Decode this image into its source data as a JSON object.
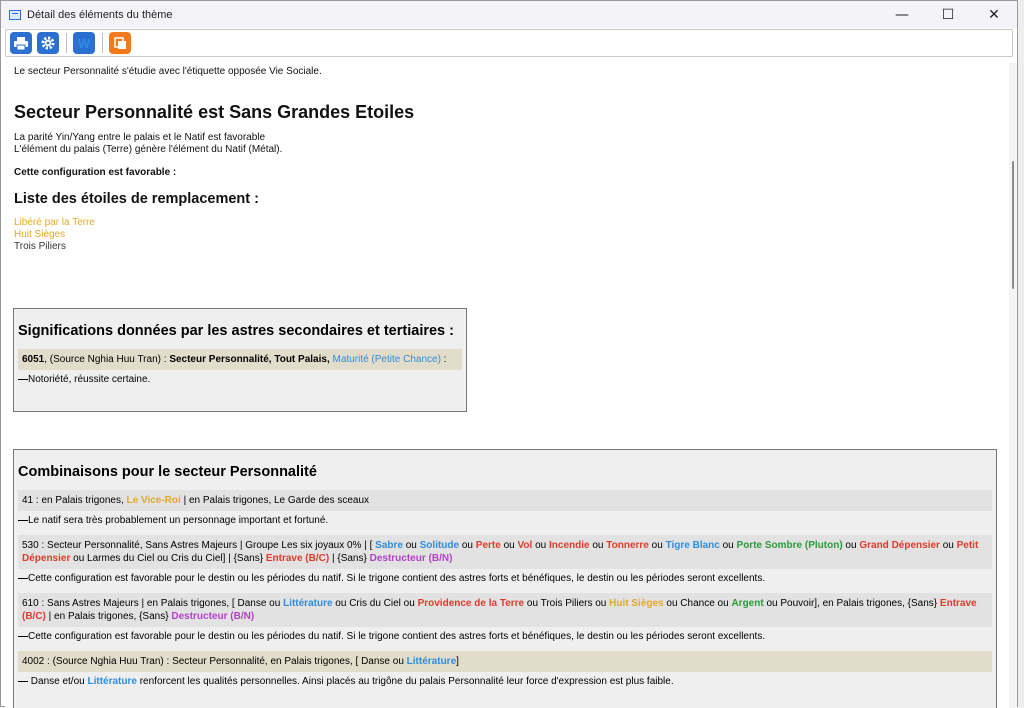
{
  "window": {
    "title": "Détail des éléments du thème",
    "minimize": "—",
    "maximize": "☐",
    "close": "✕"
  },
  "toolbar": {
    "print_icon": "print-icon",
    "settings_icon": "gear-icon",
    "word_label": "W",
    "export_icon": "copy-icon"
  },
  "intro": {
    "line": "Le secteur Personnalité s'étudie avec l'étiquette opposée Vie Sociale."
  },
  "section1": {
    "title": "Secteur Personnalité est Sans Grandes Etoiles",
    "line1": "La parité Yin/Yang entre le palais et le Natif est favorable",
    "line2": "L'élément du palais (Terre) génère l'élément du Natif (Métal).",
    "config": "Cette configuration est favorable :"
  },
  "replacement": {
    "title": "Liste des étoiles de remplacement :",
    "stars": [
      "Libéré par la Terre",
      "Huit Sièges",
      "Trois Piliers"
    ]
  },
  "significations": {
    "title": "Significations données par les astres secondaires et tertiaires :",
    "entry": {
      "id": "6051",
      "source": ", (Source Nghia Huu Tran) : ",
      "sector": "Secteur Personnalité, Tout Palais, ",
      "star": "Maturité (Petite Chance)",
      "colon": " :",
      "desc": "Notoriété, réussite certaine."
    }
  },
  "combinaisons": {
    "title": "Combinaisons pour le secteur Personnalité",
    "c41": {
      "pre": "41 : en Palais trigones, ",
      "star": "Le Vice-Roi",
      "post": " | en Palais trigones, Le Garde des sceaux",
      "desc": "Le natif sera très probablement un personnage important et fortuné."
    },
    "c530": {
      "pre": "530 : Secteur Personnalité, Sans Astres Majeurs | Groupe Les six joyaux 0% | [ ",
      "s1": "Sabre",
      "s2": "Solitude",
      "s3": "Perte",
      "s4": "Vol",
      "s5": "Incendie",
      "s6": "Tonnerre",
      "s7": "Tigre Blanc",
      "s8": "Porte Sombre (Pluton)",
      "s9": "Grand Dépensier",
      "s10": "Petit Dépensier",
      "mid": " ou Larmes du Ciel ou Cris du Ciel] | {Sans} ",
      "s11": "Entrave (B/C)",
      "mid2": " | {Sans} ",
      "s12": "Destructeur (B/N)",
      "ou": " ou ",
      "desc": "Cette configuration est favorable pour le destin ou les périodes du natif. Si le trigone contient des astres forts et bénéfiques, le destin ou les périodes seront excellents."
    },
    "c610": {
      "pre": "610 : Sans Astres Majeurs | en Palais trigones, [ Danse ou ",
      "s1": "Littérature",
      "t1": " ou Cris du Ciel ou ",
      "s2": "Providence de la Terre",
      "t2": " ou Trois Piliers ou ",
      "s3": "Huit Sièges",
      "t3": " ou Chance ou ",
      "s4": "Argent",
      "t4": " ou Pouvoir], en Palais trigones, {Sans} ",
      "s5": "Entrave (B/C)",
      "t5": " | en Palais trigones, {Sans} ",
      "s6": "Destructeur (B/N)",
      "desc": "Cette configuration est favorable pour le destin ou les périodes du natif. Si le trigone contient des astres forts et bénéfiques, le destin ou les périodes seront excellents."
    },
    "c4002": {
      "pre": "4002 : (Source Nghia Huu Tran) : Secteur Personnalité, en Palais trigones, [ Danse ou ",
      "s1": "Littérature",
      "post": "]",
      "desc_pre": "Danse et/ou ",
      "desc_star": "Littérature",
      "desc_post": " renforcent les qualités personnelles. Ainsi placés au trigône du palais Personnalité leur force d'expression est plus faible."
    }
  },
  "colors": {
    "gold": "#e2a92b",
    "blue": "#2e8ddf",
    "red": "#e03b2b",
    "green": "#2b9a3a",
    "purple": "#b341c9"
  }
}
